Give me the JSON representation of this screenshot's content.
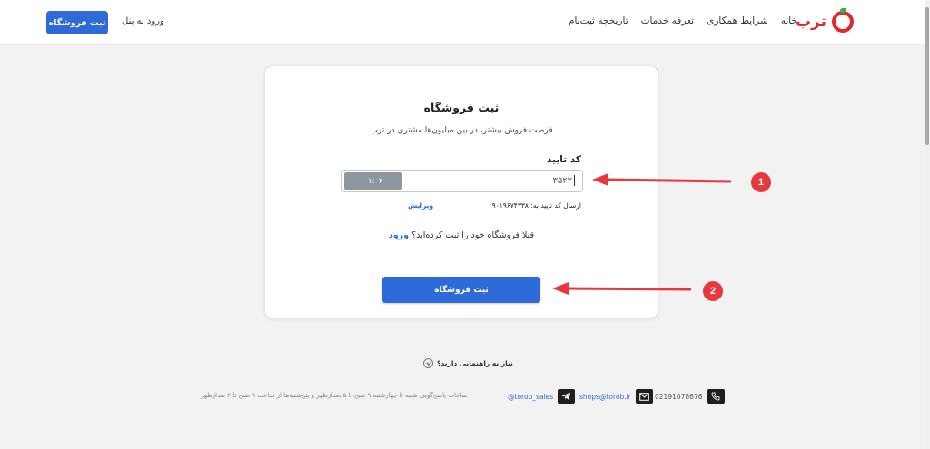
{
  "header": {
    "logo_text": "ترب",
    "nav": [
      {
        "label": "خانه"
      },
      {
        "label": "شرایط همکاری"
      },
      {
        "label": "تعرفه خدمات"
      },
      {
        "label": "تاریخچه ثبت‌نام"
      }
    ],
    "login_panel_label": "ورود به پنل",
    "register_button_label": "ثبت فروشگاه",
    "brand_color": "#e0282c",
    "accent_color": "#2f6bd8"
  },
  "card": {
    "title": "ثبت فروشگاه",
    "subtitle": "فرصت فروش بیشتر، در بین میلیون‌ها مشتری در ترب",
    "code_label": "کد تایید",
    "code_value": "۳۵۲۲",
    "timer": "۰۱:۰۴",
    "sent_text": "ارسال کد تایید به: ۰۹۰۱۹۶۷۴۳۳۸",
    "edit_label": "ویرایش",
    "already_text": "قبلا فروشگاه خود را ثبت کرده‌اید؟",
    "already_login": "ورود",
    "submit_label": "ثبت فروشگاه"
  },
  "annotations": {
    "badge1": "1",
    "badge2": "2",
    "color": "#e8383d"
  },
  "help": {
    "label": "نیاز به راهنمایی دارید؟"
  },
  "footer": {
    "phone": "02191078676",
    "email": "shops@torob.ir",
    "telegram": "@torob_sales",
    "hours": "ساعات پاسخ‌گویی شنبه تا چهارشنبه ۹ صبح تا ۵ بعدازظهر و پنج‌شنبه‌ها از ساعت ۹ صبح تا ۲ بعدازظهر"
  }
}
